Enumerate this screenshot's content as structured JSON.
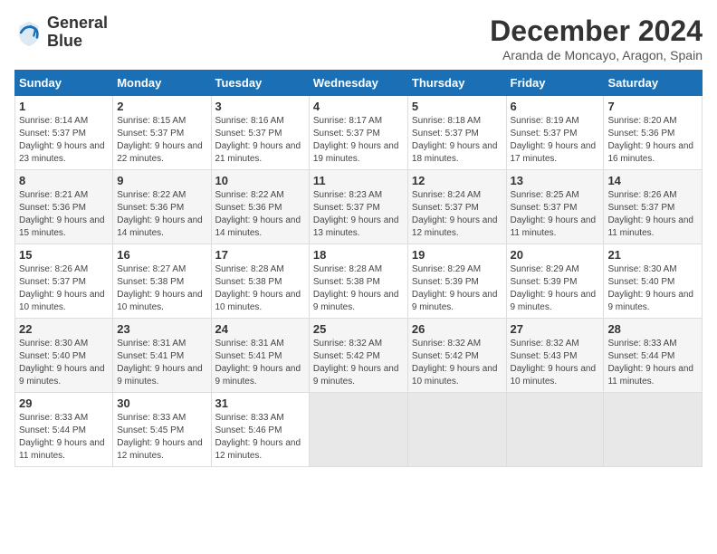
{
  "logo": {
    "line1": "General",
    "line2": "Blue"
  },
  "title": "December 2024",
  "location": "Aranda de Moncayo, Aragon, Spain",
  "days_of_week": [
    "Sunday",
    "Monday",
    "Tuesday",
    "Wednesday",
    "Thursday",
    "Friday",
    "Saturday"
  ],
  "weeks": [
    [
      {
        "day": "1",
        "sunrise": "8:14 AM",
        "sunset": "5:37 PM",
        "daylight": "9 hours and 23 minutes."
      },
      {
        "day": "2",
        "sunrise": "8:15 AM",
        "sunset": "5:37 PM",
        "daylight": "9 hours and 22 minutes."
      },
      {
        "day": "3",
        "sunrise": "8:16 AM",
        "sunset": "5:37 PM",
        "daylight": "9 hours and 21 minutes."
      },
      {
        "day": "4",
        "sunrise": "8:17 AM",
        "sunset": "5:37 PM",
        "daylight": "9 hours and 19 minutes."
      },
      {
        "day": "5",
        "sunrise": "8:18 AM",
        "sunset": "5:37 PM",
        "daylight": "9 hours and 18 minutes."
      },
      {
        "day": "6",
        "sunrise": "8:19 AM",
        "sunset": "5:37 PM",
        "daylight": "9 hours and 17 minutes."
      },
      {
        "day": "7",
        "sunrise": "8:20 AM",
        "sunset": "5:36 PM",
        "daylight": "9 hours and 16 minutes."
      }
    ],
    [
      {
        "day": "8",
        "sunrise": "8:21 AM",
        "sunset": "5:36 PM",
        "daylight": "9 hours and 15 minutes."
      },
      {
        "day": "9",
        "sunrise": "8:22 AM",
        "sunset": "5:36 PM",
        "daylight": "9 hours and 14 minutes."
      },
      {
        "day": "10",
        "sunrise": "8:22 AM",
        "sunset": "5:36 PM",
        "daylight": "9 hours and 14 minutes."
      },
      {
        "day": "11",
        "sunrise": "8:23 AM",
        "sunset": "5:37 PM",
        "daylight": "9 hours and 13 minutes."
      },
      {
        "day": "12",
        "sunrise": "8:24 AM",
        "sunset": "5:37 PM",
        "daylight": "9 hours and 12 minutes."
      },
      {
        "day": "13",
        "sunrise": "8:25 AM",
        "sunset": "5:37 PM",
        "daylight": "9 hours and 11 minutes."
      },
      {
        "day": "14",
        "sunrise": "8:26 AM",
        "sunset": "5:37 PM",
        "daylight": "9 hours and 11 minutes."
      }
    ],
    [
      {
        "day": "15",
        "sunrise": "8:26 AM",
        "sunset": "5:37 PM",
        "daylight": "9 hours and 10 minutes."
      },
      {
        "day": "16",
        "sunrise": "8:27 AM",
        "sunset": "5:38 PM",
        "daylight": "9 hours and 10 minutes."
      },
      {
        "day": "17",
        "sunrise": "8:28 AM",
        "sunset": "5:38 PM",
        "daylight": "9 hours and 10 minutes."
      },
      {
        "day": "18",
        "sunrise": "8:28 AM",
        "sunset": "5:38 PM",
        "daylight": "9 hours and 9 minutes."
      },
      {
        "day": "19",
        "sunrise": "8:29 AM",
        "sunset": "5:39 PM",
        "daylight": "9 hours and 9 minutes."
      },
      {
        "day": "20",
        "sunrise": "8:29 AM",
        "sunset": "5:39 PM",
        "daylight": "9 hours and 9 minutes."
      },
      {
        "day": "21",
        "sunrise": "8:30 AM",
        "sunset": "5:40 PM",
        "daylight": "9 hours and 9 minutes."
      }
    ],
    [
      {
        "day": "22",
        "sunrise": "8:30 AM",
        "sunset": "5:40 PM",
        "daylight": "9 hours and 9 minutes."
      },
      {
        "day": "23",
        "sunrise": "8:31 AM",
        "sunset": "5:41 PM",
        "daylight": "9 hours and 9 minutes."
      },
      {
        "day": "24",
        "sunrise": "8:31 AM",
        "sunset": "5:41 PM",
        "daylight": "9 hours and 9 minutes."
      },
      {
        "day": "25",
        "sunrise": "8:32 AM",
        "sunset": "5:42 PM",
        "daylight": "9 hours and 9 minutes."
      },
      {
        "day": "26",
        "sunrise": "8:32 AM",
        "sunset": "5:42 PM",
        "daylight": "9 hours and 10 minutes."
      },
      {
        "day": "27",
        "sunrise": "8:32 AM",
        "sunset": "5:43 PM",
        "daylight": "9 hours and 10 minutes."
      },
      {
        "day": "28",
        "sunrise": "8:33 AM",
        "sunset": "5:44 PM",
        "daylight": "9 hours and 11 minutes."
      }
    ],
    [
      {
        "day": "29",
        "sunrise": "8:33 AM",
        "sunset": "5:44 PM",
        "daylight": "9 hours and 11 minutes."
      },
      {
        "day": "30",
        "sunrise": "8:33 AM",
        "sunset": "5:45 PM",
        "daylight": "9 hours and 12 minutes."
      },
      {
        "day": "31",
        "sunrise": "8:33 AM",
        "sunset": "5:46 PM",
        "daylight": "9 hours and 12 minutes."
      },
      null,
      null,
      null,
      null
    ]
  ],
  "labels": {
    "sunrise": "Sunrise:",
    "sunset": "Sunset:",
    "daylight": "Daylight:"
  }
}
